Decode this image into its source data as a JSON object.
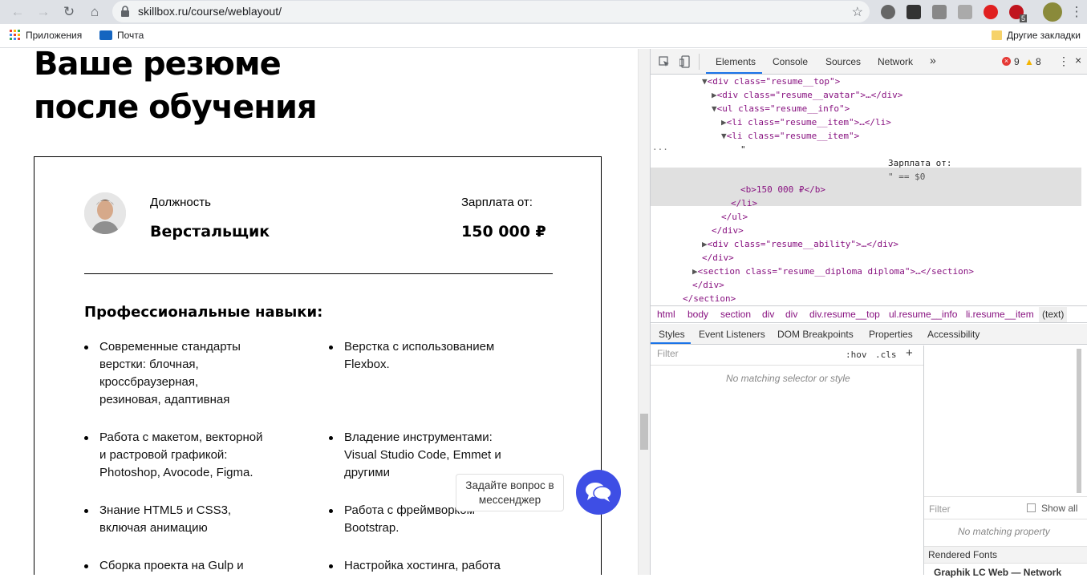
{
  "browser": {
    "url": "skillbox.ru/course/weblayout/",
    "ext_badge": "5"
  },
  "bookmarks": {
    "apps": "Приложения",
    "mail": "Почта",
    "other": "Другие закладки"
  },
  "page": {
    "title_line1": "Ваше резюме",
    "title_line2": "после обучения",
    "position_label": "Должность",
    "position_value": "Верстальщик",
    "salary_label": "Зарплата от:",
    "salary_value": "150 000 ₽",
    "skills_title": "Профессиональные навыки:",
    "skills": [
      [
        "Современные стандарты",
        "верстки: блочная,",
        "кроссбраузерная,",
        "резиновая, адаптивная"
      ],
      [
        "Верстка с использованием",
        "Flexbox."
      ],
      [
        "Работа с макетом, векторной",
        "и растровой графикой:",
        "Photoshop, Avocode, Figma."
      ],
      [
        "Владение инструментами:",
        "Visual Studio Code, Emmet и",
        "другими"
      ],
      [
        "Знание HTML5 и CSS3,",
        "включая анимацию"
      ],
      [
        "Работа с фреймворком",
        "Bootstrap."
      ],
      [
        "Сборка проекта на Gulp и"
      ],
      [
        "Настройка хостинга, работа"
      ]
    ],
    "chat_tooltip_1": "Задайте вопрос в",
    "chat_tooltip_2": "мессенджер"
  },
  "devtools": {
    "tabs": [
      "Elements",
      "Console",
      "Sources",
      "Network"
    ],
    "errors": "9",
    "warnings": "8",
    "tree": {
      "l1": "<div class=\"resume__top\">",
      "l2": "<div class=\"resume__avatar\">…</div>",
      "l3": "<ul class=\"resume__info\">",
      "l4": "<li class=\"resume__item\">…</li>",
      "l5": "<li class=\"resume__item\">",
      "sel_quote": "\"",
      "sel_text": "Зарплата от:",
      "sel_eq": "\" == $0",
      "l6": "<b>150 000 ₽</b>",
      "l7": "</li>",
      "l8": "</ul>",
      "l9": "</div>",
      "l10": "<div class=\"resume__ability\">…</div>",
      "l11": "</div>",
      "l12": "<section class=\"resume__diploma diploma\">…</section>",
      "l13": "</div>",
      "l14": "</section>"
    },
    "breadcrumbs": [
      "html",
      "body",
      "section",
      "div",
      "div",
      "div.resume__top",
      "ul.resume__info",
      "li.resume__item",
      "(text)"
    ],
    "subtabs": [
      "Styles",
      "Event Listeners",
      "DOM Breakpoints",
      "Properties",
      "Accessibility"
    ],
    "filter_placeholder": "Filter",
    "hov": ":hov",
    "cls": ".cls",
    "no_style": "No matching selector or style",
    "computed_filter": "Filter",
    "show_all": "Show all",
    "no_property": "No matching property",
    "rendered_fonts": "Rendered Fonts",
    "font_row": "Graphik LC Web — Network"
  }
}
